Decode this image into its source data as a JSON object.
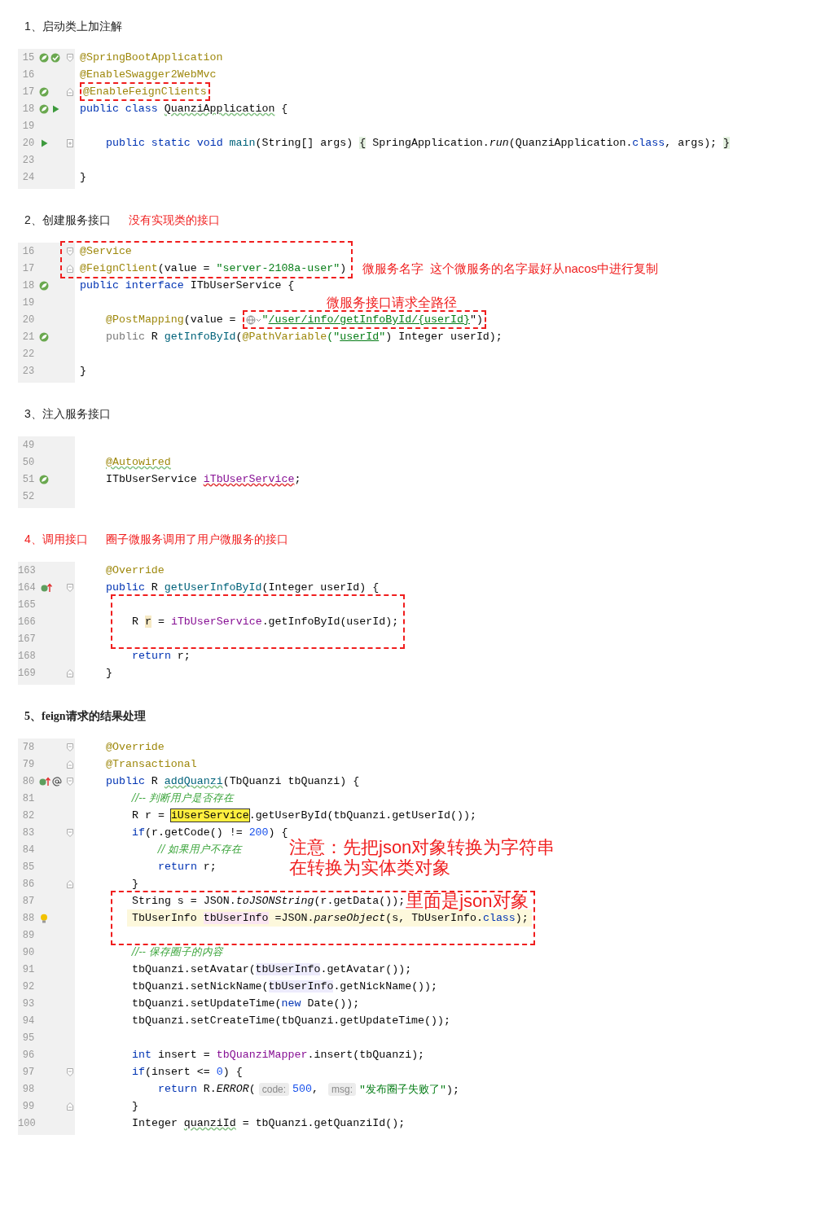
{
  "sections": [
    {
      "heading": "1、启动类上加注解",
      "kind": "plain",
      "lines": [
        {
          "kind": "top",
          "number": "15",
          "gutter": [
            {
              "kind": "bean"
            },
            {
              "kind": "check"
            },
            {
              "kind": "fold-start"
            }
          ],
          "current": false,
          "tokens": [
            {
              "text": "@SpringBootApplication",
              "kind": "ann"
            }
          ]
        },
        {
          "kind": "top",
          "number": "16",
          "current": false,
          "tokens": [
            {
              "text": "@EnableSwagger2WebMvc",
              "kind": "ann"
            }
          ]
        },
        {
          "kind": "top",
          "number": "17",
          "gutter": [
            {
              "kind": "bean"
            },
            {
              "kind": "fold-end"
            }
          ],
          "current": false,
          "tokens": [
            {
              "kind": "box",
              "parts": [
                {
                  "text": "@EnableFeignClients",
                  "kind": "ann"
                }
              ]
            }
          ]
        },
        {
          "kind": "top",
          "number": "18",
          "gutter": [
            {
              "kind": "bean"
            },
            {
              "kind": "run"
            }
          ],
          "current": false,
          "tokens": [
            {
              "text": "public class ",
              "kind": "kw"
            },
            {
              "text": "QuanziApplication",
              "kind": "p-wavy"
            },
            {
              "text": " {",
              "kind": "p"
            }
          ]
        },
        {
          "kind": "top",
          "number": "19",
          "current": false
        },
        {
          "kind": "inner",
          "number": "20",
          "gutter": [
            {
              "kind": "run"
            },
            {
              "kind": "fold-plus"
            }
          ],
          "current": false,
          "tokens": [
            {
              "text": "public static void ",
              "kind": "kw"
            },
            {
              "text": "main",
              "kind": "fn"
            },
            {
              "text": "(String[] args) ",
              "kind": "p"
            },
            {
              "text": "{",
              "kind": "brace"
            },
            {
              "text": " SpringApplication.",
              "kind": "p"
            },
            {
              "text": "run",
              "kind": "it"
            },
            {
              "text": "(QuanziApplication.",
              "kind": "p"
            },
            {
              "text": "class",
              "kind": "kw"
            },
            {
              "text": ", args); ",
              "kind": "p"
            },
            {
              "text": "}",
              "kind": "brace"
            }
          ]
        },
        {
          "kind": "top",
          "number": "23",
          "current": false
        },
        {
          "kind": "top",
          "number": "24",
          "current": false,
          "tokens": [
            {
              "text": "}",
              "kind": "p"
            }
          ]
        }
      ]
    },
    {
      "heading": "2、创建服务接口",
      "kind": "plain",
      "notes": [
        "没有实现类的接口"
      ],
      "lines": [
        {
          "kind": "frame",
          "notes": [
            "微服务名字",
            "这个微服务的名字最好从nacos中进行复制"
          ],
          "lines": [
            {
              "kind": "top",
              "number": "16",
              "gutter": [
                {
                  "kind": "fold-start"
                }
              ],
              "current": false,
              "tokens": [
                {
                  "text": "@Service",
                  "kind": "ann"
                }
              ]
            },
            {
              "kind": "top",
              "number": "17",
              "gutter": [
                {
                  "kind": "fold-end"
                }
              ],
              "current": false,
              "tokens": [
                {
                  "text": "@FeignClient",
                  "kind": "ann"
                },
                {
                  "text": "(value = ",
                  "kind": "p"
                },
                {
                  "text": "\"server-2108a-user\"",
                  "kind": "str"
                },
                {
                  "text": ")",
                  "kind": "p"
                }
              ]
            }
          ]
        },
        {
          "kind": "top",
          "number": "18",
          "gutter": [
            {
              "kind": "bean"
            }
          ],
          "current": false,
          "tokens": [
            {
              "text": "public interface ",
              "kind": "kw"
            },
            {
              "text": "ITbUserService {",
              "kind": "p"
            }
          ]
        },
        {
          "kind": "top",
          "number": "19",
          "current": false,
          "note": {
            "text": "微服务接口请求全路径",
            "kind": "offset"
          }
        },
        {
          "kind": "inner",
          "number": "20",
          "current": false,
          "tokens": [
            {
              "text": "@PostMapping",
              "kind": "ann"
            },
            {
              "text": "(value = ",
              "kind": "p"
            },
            {
              "kind": "box",
              "parts": [
                {
                  "kind": "globe"
                },
                {
                  "text": "\"",
                  "kind": "str"
                },
                {
                  "text": "/user/info/getInfoById/{userId}",
                  "kind": "link"
                },
                {
                  "text": "\")",
                  "kind": "p"
                }
              ]
            }
          ]
        },
        {
          "kind": "inner",
          "number": "21",
          "gutter": [
            {
              "kind": "bean"
            }
          ],
          "current": false,
          "tokens": [
            {
              "text": "public ",
              "kind": "dim"
            },
            {
              "text": "R ",
              "kind": "p"
            },
            {
              "text": "getInfoById",
              "kind": "fn"
            },
            {
              "text": "(",
              "kind": "p"
            },
            {
              "text": "@PathVariable",
              "kind": "ann"
            },
            {
              "text": "(\"",
              "kind": "str"
            },
            {
              "text": "userId",
              "kind": "link"
            },
            {
              "text": "\"",
              "kind": "str"
            },
            {
              "text": ") Integer userId);",
              "kind": "p"
            }
          ]
        },
        {
          "kind": "top",
          "number": "22",
          "current": false
        },
        {
          "kind": "top",
          "number": "23",
          "current": false,
          "tokens": [
            {
              "text": "}",
              "kind": "p"
            }
          ]
        }
      ]
    },
    {
      "heading": "3、注入服务接口",
      "kind": "plain",
      "lines": [
        {
          "kind": "top",
          "number": "49",
          "current": false
        },
        {
          "kind": "inner",
          "number": "50",
          "current": false,
          "tokens": [
            {
              "text": "@Autowired",
              "kind": "ann-wavy"
            }
          ]
        },
        {
          "kind": "inner",
          "number": "51",
          "gutter": [
            {
              "kind": "bean"
            }
          ],
          "current": false,
          "tokens": [
            {
              "text": "ITbUserService ",
              "kind": "p"
            },
            {
              "text": "iTbUserService",
              "kind": "fld-wavy"
            },
            {
              "text": ";",
              "kind": "p"
            }
          ]
        },
        {
          "kind": "top",
          "number": "52",
          "current": false
        }
      ]
    },
    {
      "heading": "4、调用接口",
      "kind": "red",
      "notes": [
        "圈子微服务调用了用户微服务的接口"
      ],
      "lines": [
        {
          "kind": "inner",
          "number": "163",
          "current": false,
          "tokens": [
            {
              "text": "@Override",
              "kind": "ann"
            }
          ]
        },
        {
          "kind": "inner",
          "number": "164",
          "gutter": [
            {
              "kind": "impl"
            },
            {
              "kind": "fold-start"
            }
          ],
          "current": false,
          "tokens": [
            {
              "text": "public ",
              "kind": "kw"
            },
            {
              "text": "R ",
              "kind": "p"
            },
            {
              "text": "getUserInfoById",
              "kind": "fn"
            },
            {
              "text": "(Integer userId) {",
              "kind": "p"
            }
          ]
        },
        {
          "kind": "box",
          "lines": [
            {
              "kind": "top",
              "number": "165",
              "current": false
            },
            {
              "kind": "top",
              "number": "166",
              "current": false,
              "tokens": [
                {
                  "text": "R ",
                  "kind": "p"
                },
                {
                  "text": "r",
                  "kind": "mark"
                },
                {
                  "text": " = ",
                  "kind": "p"
                },
                {
                  "text": "iTbUserService",
                  "kind": "fld"
                },
                {
                  "text": ".getInfoById(userId);",
                  "kind": "p"
                }
              ]
            },
            {
              "kind": "top",
              "number": "167",
              "current": false
            }
          ]
        },
        {
          "kind": "nested",
          "number": "168",
          "current": false,
          "tokens": [
            {
              "text": "return ",
              "kind": "kw"
            },
            {
              "text": "r;",
              "kind": "p"
            }
          ]
        },
        {
          "kind": "inner",
          "number": "169",
          "gutter": [
            {
              "kind": "fold-end"
            }
          ],
          "current": false,
          "tokens": [
            {
              "text": "}",
              "kind": "p"
            }
          ]
        }
      ]
    },
    {
      "heading": "5、feign请求的结果处理",
      "kind": "bold",
      "lines": [
        {
          "kind": "inner",
          "number": "78",
          "gutter": [
            {
              "kind": "fold-start"
            }
          ],
          "current": false,
          "tokens": [
            {
              "text": "@Override",
              "kind": "ann"
            }
          ]
        },
        {
          "kind": "inner",
          "number": "79",
          "gutter": [
            {
              "kind": "fold-end"
            }
          ],
          "current": false,
          "tokens": [
            {
              "text": "@Transactional",
              "kind": "ann"
            }
          ]
        },
        {
          "kind": "inner",
          "number": "80",
          "gutter": [
            {
              "kind": "impl"
            },
            {
              "kind": "at"
            },
            {
              "kind": "fold-start"
            }
          ],
          "current": false,
          "tokens": [
            {
              "text": "public ",
              "kind": "kw"
            },
            {
              "text": "R ",
              "kind": "p"
            },
            {
              "text": "addQuanzi",
              "kind": "fn-wavy"
            },
            {
              "text": "(TbQuanzi tbQuanzi) {",
              "kind": "p"
            }
          ]
        },
        {
          "kind": "nested",
          "number": "81",
          "current": false,
          "tokens": [
            {
              "text": "//-- 判断用户是否存在",
              "kind": "cmt"
            }
          ]
        },
        {
          "kind": "nested",
          "number": "82",
          "current": false,
          "tokens": [
            {
              "text": "R r = ",
              "kind": "p"
            },
            {
              "text": "iUserService",
              "kind": "hl"
            },
            {
              "text": ".getUserById(tbQuanzi.getUserId());",
              "kind": "p"
            }
          ]
        },
        {
          "kind": "nested",
          "number": "83",
          "gutter": [
            {
              "kind": "fold-start"
            }
          ],
          "current": false,
          "tokens": [
            {
              "text": "if",
              "kind": "kw"
            },
            {
              "text": "(r.getCode() != ",
              "kind": "p"
            },
            {
              "text": "200",
              "kind": "num"
            },
            {
              "text": ") {",
              "kind": "p"
            }
          ]
        },
        {
          "kind": "deep",
          "number": "84",
          "current": false,
          "tokens": [
            {
              "text": "// 如果用户不存在",
              "kind": "cmt"
            }
          ],
          "note": {
            "text": "注意：先把json对象转换为字符串",
            "kind": "float"
          }
        },
        {
          "kind": "deep",
          "number": "85",
          "current": false,
          "tokens": [
            {
              "text": "return ",
              "kind": "kw"
            },
            {
              "text": "r;",
              "kind": "p"
            }
          ],
          "note": {
            "text": "在转换为实体类对象",
            "kind": "drop"
          }
        },
        {
          "kind": "nested",
          "number": "86",
          "gutter": [
            {
              "kind": "fold-end"
            }
          ],
          "current": false,
          "tokens": [
            {
              "text": "}",
              "kind": "p"
            }
          ]
        },
        {
          "kind": "box",
          "lines": [
            {
              "kind": "top",
              "number": "87",
              "current": false,
              "tokens": [
                {
                  "text": "String s = JSON.",
                  "kind": "p"
                },
                {
                  "text": "toJSONString",
                  "kind": "it"
                },
                {
                  "text": "(r.getData());",
                  "kind": "p"
                }
              ],
              "note": {
                "text": "里面是json对象",
                "kind": "inline"
              }
            },
            {
              "kind": "top",
              "number": "88",
              "gutter": [
                {
                  "kind": "bulb"
                }
              ],
              "current": true,
              "tokens": [
                {
                  "text": "TbUserInfo ",
                  "kind": "p"
                },
                {
                  "text": "tbUserInfo",
                  "kind": "use"
                },
                {
                  "text": " =JSON.",
                  "kind": "p"
                },
                {
                  "text": "parseObject",
                  "kind": "it"
                },
                {
                  "text": "(s, TbUserInfo.",
                  "kind": "p"
                },
                {
                  "text": "class",
                  "kind": "kw"
                },
                {
                  "text": ");",
                  "kind": "p"
                }
              ]
            },
            {
              "kind": "top",
              "number": "89",
              "current": false
            }
          ]
        },
        {
          "kind": "nested",
          "number": "90",
          "current": false,
          "tokens": [
            {
              "text": "//-- 保存圈子的内容",
              "kind": "cmt"
            }
          ]
        },
        {
          "kind": "nested",
          "number": "91",
          "current": false,
          "tokens": [
            {
              "text": "tbQuanzi.setAvatar(",
              "kind": "p"
            },
            {
              "text": "tbUserInfo",
              "kind": "read"
            },
            {
              "text": ".getAvatar());",
              "kind": "p"
            }
          ]
        },
        {
          "kind": "nested",
          "number": "92",
          "current": false,
          "tokens": [
            {
              "text": "tbQuanzi.setNickName(",
              "kind": "p"
            },
            {
              "text": "tbUserInfo",
              "kind": "read"
            },
            {
              "text": ".getNickName());",
              "kind": "p"
            }
          ]
        },
        {
          "kind": "nested",
          "number": "93",
          "current": false,
          "tokens": [
            {
              "text": "tbQuanzi.setUpdateTime(",
              "kind": "p"
            },
            {
              "text": "new",
              "kind": "kw"
            },
            {
              "text": " Date());",
              "kind": "p"
            }
          ]
        },
        {
          "kind": "nested",
          "number": "94",
          "current": false,
          "tokens": [
            {
              "text": "tbQuanzi.setCreateTime(tbQuanzi.getUpdateTime());",
              "kind": "p"
            }
          ]
        },
        {
          "kind": "top",
          "number": "95",
          "current": false
        },
        {
          "kind": "nested",
          "number": "96",
          "current": false,
          "tokens": [
            {
              "text": "int ",
              "kind": "kw"
            },
            {
              "text": "insert = ",
              "kind": "p"
            },
            {
              "text": "tbQuanziMapper",
              "kind": "fld"
            },
            {
              "text": ".insert(tbQuanzi);",
              "kind": "p"
            }
          ]
        },
        {
          "kind": "nested",
          "number": "97",
          "gutter": [
            {
              "kind": "fold-start"
            }
          ],
          "current": false,
          "tokens": [
            {
              "text": "if",
              "kind": "kw"
            },
            {
              "text": "(insert <= ",
              "kind": "p"
            },
            {
              "text": "0",
              "kind": "num"
            },
            {
              "text": ") {",
              "kind": "p"
            }
          ]
        },
        {
          "kind": "deep",
          "number": "98",
          "current": false,
          "tokens": [
            {
              "text": "return ",
              "kind": "kw"
            },
            {
              "text": "R.",
              "kind": "p"
            },
            {
              "text": "ERROR",
              "kind": "it"
            },
            {
              "text": "(",
              "kind": "p"
            },
            {
              "text": "code:",
              "kind": "hint"
            },
            {
              "text": "500",
              "kind": "num"
            },
            {
              "text": ", ",
              "kind": "p"
            },
            {
              "text": "msg:",
              "kind": "hint"
            },
            {
              "text": "\"发布圈子失败了\"",
              "kind": "str"
            },
            {
              "text": ");",
              "kind": "p"
            }
          ]
        },
        {
          "kind": "nested",
          "number": "99",
          "gutter": [
            {
              "kind": "fold-end"
            }
          ],
          "current": false,
          "tokens": [
            {
              "text": "}",
              "kind": "p"
            }
          ]
        },
        {
          "kind": "nested",
          "number": "100",
          "current": false,
          "tokens": [
            {
              "text": "Integer ",
              "kind": "p"
            },
            {
              "text": "quanziId",
              "kind": "p-wavy"
            },
            {
              "text": " = tbQuanzi.getQuanziId();",
              "kind": "p"
            }
          ]
        }
      ]
    }
  ]
}
